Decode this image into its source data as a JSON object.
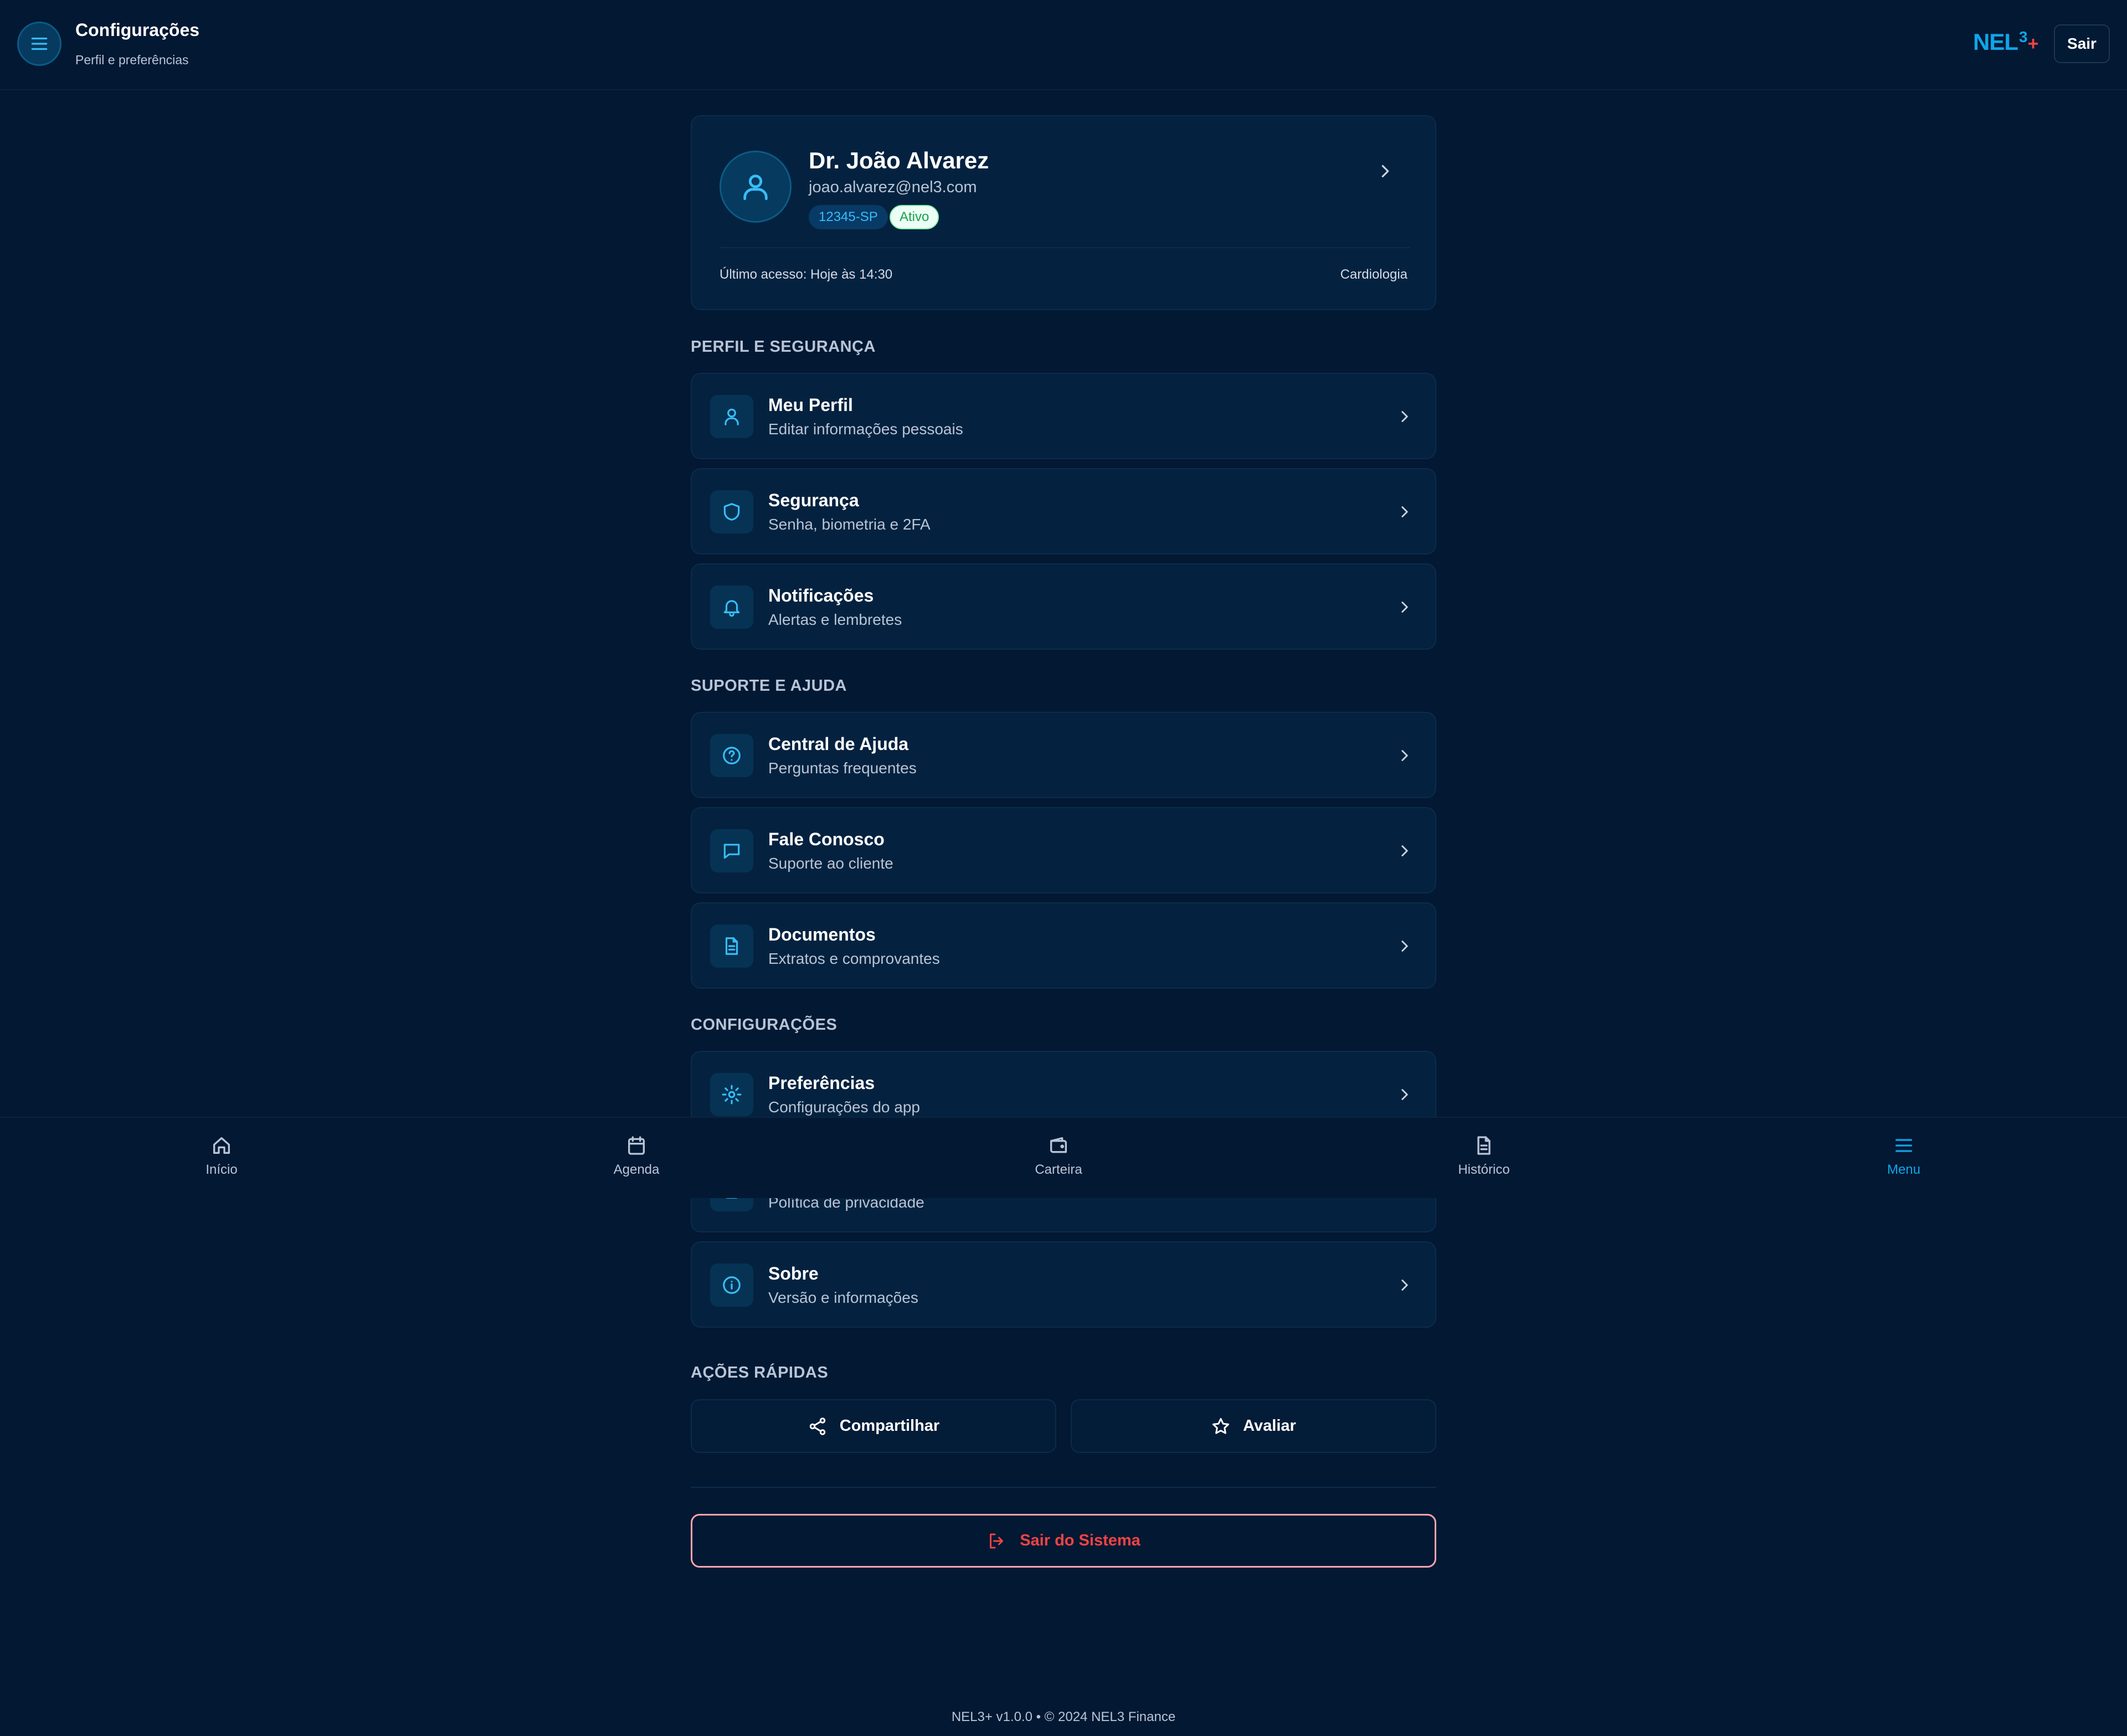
{
  "header": {
    "title": "Configurações",
    "subtitle": "Perfil e preferências",
    "brand_main": "NEL",
    "brand_sup": "3",
    "brand_plus": "+",
    "logout_label": "Sair"
  },
  "profile": {
    "name": "Dr. João Alvarez",
    "email": "joao.alvarez@nel3.com",
    "crm": "12345-SP",
    "status": "Ativo",
    "last_access": "Último acesso: Hoje às 14:30",
    "specialty": "Cardiologia"
  },
  "sections": {
    "profile_security": "PERFIL E SEGURANÇA",
    "support": "SUPORTE E AJUDA",
    "settings": "CONFIGURAÇÕES",
    "quick_actions": "AÇÕES RÁPIDAS"
  },
  "items": {
    "my_profile": {
      "title": "Meu Perfil",
      "subtitle": "Editar informações pessoais",
      "icon": "user-icon"
    },
    "security": {
      "title": "Segurança",
      "subtitle": "Senha, biometria e 2FA",
      "icon": "shield-icon"
    },
    "notifications": {
      "title": "Notificações",
      "subtitle": "Alertas e lembretes",
      "icon": "bell-icon"
    },
    "help_center": {
      "title": "Central de Ajuda",
      "subtitle": "Perguntas frequentes",
      "icon": "help-circle-icon"
    },
    "contact": {
      "title": "Fale Conosco",
      "subtitle": "Suporte ao cliente",
      "icon": "message-icon"
    },
    "documents": {
      "title": "Documentos",
      "subtitle": "Extratos e comprovantes",
      "icon": "document-icon"
    },
    "preferences": {
      "title": "Preferências",
      "subtitle": "Configurações do app",
      "icon": "gear-icon"
    },
    "privacy": {
      "subtitle": "Política de privacidade",
      "icon": "lock-icon"
    },
    "about": {
      "title": "Sobre",
      "subtitle": "Versão e informações",
      "icon": "info-icon"
    }
  },
  "quick_actions": {
    "share": "Compartilhar",
    "rate": "Avaliar"
  },
  "exit_label": "Sair do Sistema",
  "footer": "NEL3+ v1.0.0 • © 2024 NEL3 Finance",
  "bottom_nav": {
    "home": "Início",
    "agenda": "Agenda",
    "wallet": "Carteira",
    "history": "Histórico",
    "menu": "Menu",
    "active": "menu"
  },
  "colors": {
    "background": "#021833",
    "card": "#04223f",
    "accent": "#0ea5e9",
    "danger": "#ef4444",
    "success": "#16a34a"
  }
}
